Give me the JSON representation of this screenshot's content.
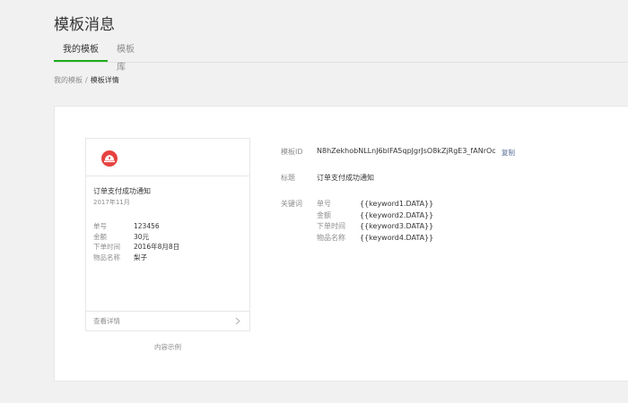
{
  "header": {
    "title": "模板消息"
  },
  "tabs": [
    {
      "label": "我的模板"
    },
    {
      "label": "模板库"
    }
  ],
  "breadcrumb": {
    "parent": "我的模板",
    "separator": "/",
    "current": "模板详情"
  },
  "preview": {
    "title": "订单支付成功通知",
    "date": "2017年11月",
    "fields": [
      {
        "key": "单号",
        "value": "123456"
      },
      {
        "key": "金额",
        "value": "30元"
      },
      {
        "key": "下单时间",
        "value": "2016年8月8日"
      },
      {
        "key": "物品名称",
        "value": "梨子"
      }
    ],
    "more_label": "查看详情",
    "caption": "内容示例"
  },
  "info": {
    "id_label": "模板ID",
    "id_value": "N8hZekhobNLLnJ6bIFA5qpJgrJsO8kZjRgE3_fANrOc",
    "copy_label": "复制",
    "title_label": "标题",
    "title_value": "订单支付成功通知",
    "keywords_label": "关键词",
    "keywords": [
      {
        "key": "单号",
        "value": "{{keyword1.DATA}}"
      },
      {
        "key": "金额",
        "value": "{{keyword2.DATA}}"
      },
      {
        "key": "下单时间",
        "value": "{{keyword3.DATA}}"
      },
      {
        "key": "物品名称",
        "value": "{{keyword4.DATA}}"
      }
    ]
  },
  "colors": {
    "accent": "#1aad19",
    "logo": "#e64340",
    "link": "#576b95"
  }
}
